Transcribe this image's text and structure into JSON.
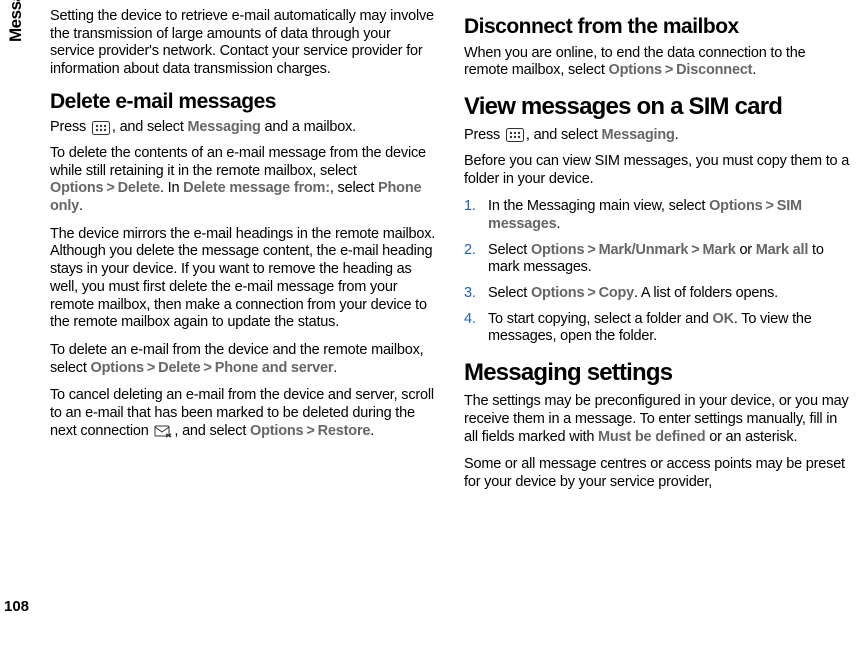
{
  "sidebar": {
    "section_title": "Messaging",
    "page_number": "108"
  },
  "left_column": {
    "intro_para": "Setting the device to retrieve e-mail automatically may involve the transmission of large amounts of data through your service provider's network. Contact your service provider for information about data transmission charges.",
    "heading_delete": "Delete e-mail messages",
    "press_prefix": "Press ",
    "press_mid": ", and select ",
    "messaging_label": "Messaging",
    "press_suffix": " and a mailbox.",
    "delete_para1_a": "To delete the contents of an e-mail message from the device while still retaining it in the remote mailbox, select ",
    "options_label": "Options",
    "delete_label": "Delete",
    "delete_para1_b": ". In ",
    "delete_msg_from": "Delete message from:",
    "delete_para1_c": ", select ",
    "phone_only": "Phone only",
    "period": ".",
    "mirror_para": "The device mirrors the e-mail headings in the remote mailbox. Although you delete the message content, the e-mail heading stays in your device. If you want to remove the heading as well, you must first delete the e-mail message from your remote mailbox, then make a connection from your device to the remote mailbox again to update the status.",
    "delete_both_a": "To delete an e-mail from the device and the remote mailbox, select ",
    "phone_and_server": "Phone and server",
    "cancel_para_a": "To cancel deleting an e-mail from the device and server, scroll to an e-mail that has been marked to be deleted during the next connection ",
    "cancel_para_b": ", and select ",
    "restore_label": "Restore"
  },
  "right_column": {
    "heading_disconnect": "Disconnect from the mailbox",
    "disconnect_para_a": "When you are online, to end the data connection to the remote mailbox, select ",
    "options_label": "Options",
    "disconnect_label": "Disconnect",
    "period": ".",
    "heading_sim": "View messages on a SIM card",
    "press_prefix": "Press ",
    "press_mid": ", and select ",
    "messaging_label": "Messaging",
    "sim_intro": "Before you can view SIM messages, you must copy them to a folder in your device.",
    "step1_a": "In the Messaging main view, select ",
    "sim_messages": "SIM messages",
    "step2_a": "Select ",
    "mark_unmark": "Mark/Unmark",
    "mark": "Mark",
    "step2_or": " or ",
    "mark_all": "Mark all",
    "step2_b": " to mark messages.",
    "step3_a": "Select ",
    "copy_label": "Copy",
    "step3_b": ". A list of folders opens.",
    "step4_a": "To start copying, select a folder and ",
    "ok_label": "OK",
    "step4_b": ". To view the messages, open the folder.",
    "heading_settings": "Messaging settings",
    "settings_para_a": "The settings may be preconfigured in your device, or you may receive them in a message. To enter settings manually, fill in all fields marked with ",
    "must_be_defined": "Must be defined",
    "settings_para_b": " or an asterisk.",
    "settings_para2": "Some or all message centres or access points may be preset for your device by your service provider,"
  },
  "gt_symbol": ">"
}
